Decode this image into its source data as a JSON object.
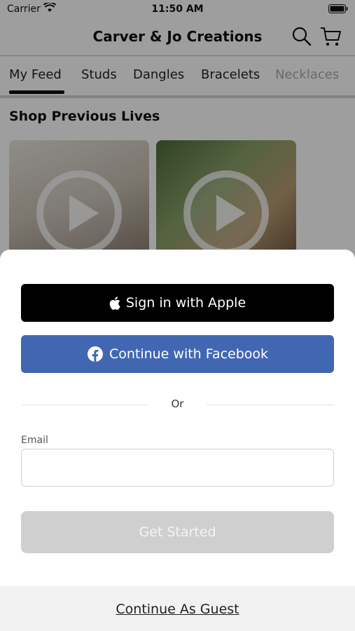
{
  "status_bar": {
    "carrier": "Carrier",
    "time": "11:50 AM"
  },
  "nav": {
    "title": "Carver & Jo Creations"
  },
  "tabs": [
    {
      "label": "My Feed",
      "active": true
    },
    {
      "label": "Studs"
    },
    {
      "label": "Dangles"
    },
    {
      "label": "Bracelets"
    },
    {
      "label": "Necklaces"
    }
  ],
  "section": {
    "title": "Shop Previous Lives"
  },
  "sheet": {
    "apple_label": "Sign in with Apple",
    "facebook_label": "Continue with Facebook",
    "or_label": "Or",
    "email_label": "Email",
    "email_value": "",
    "email_placeholder": "",
    "get_started_label": "Get Started",
    "guest_label": "Continue As Guest"
  },
  "colors": {
    "apple_bg": "#000000",
    "facebook_bg": "#4267b2",
    "get_started_disabled_bg": "#cfcfcf"
  }
}
